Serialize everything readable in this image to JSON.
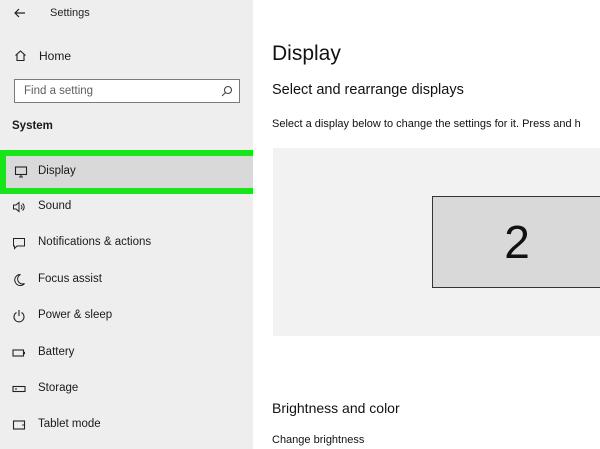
{
  "window": {
    "title": "Settings"
  },
  "sidebar": {
    "home_label": "Home",
    "search_placeholder": "Find a setting",
    "section_label": "System",
    "items": [
      {
        "label": "Display",
        "icon": "monitor-icon",
        "selected": true
      },
      {
        "label": "Sound",
        "icon": "speaker-icon"
      },
      {
        "label": "Notifications & actions",
        "icon": "notification-icon"
      },
      {
        "label": "Focus assist",
        "icon": "moon-icon"
      },
      {
        "label": "Power & sleep",
        "icon": "power-icon"
      },
      {
        "label": "Battery",
        "icon": "battery-icon"
      },
      {
        "label": "Storage",
        "icon": "storage-icon"
      },
      {
        "label": "Tablet mode",
        "icon": "tablet-icon"
      }
    ]
  },
  "main": {
    "title": "Display",
    "arrange_heading": "Select and rearrange displays",
    "arrange_desc": "Select a display below to change the settings for it. Press and h",
    "monitor_number": "2",
    "brightness_heading": "Brightness and color",
    "brightness_label": "Change brightness"
  },
  "colors": {
    "highlight": "#17e51a",
    "sidebar_bg": "#eeeeee",
    "selected_bg": "#d9d9d9"
  }
}
